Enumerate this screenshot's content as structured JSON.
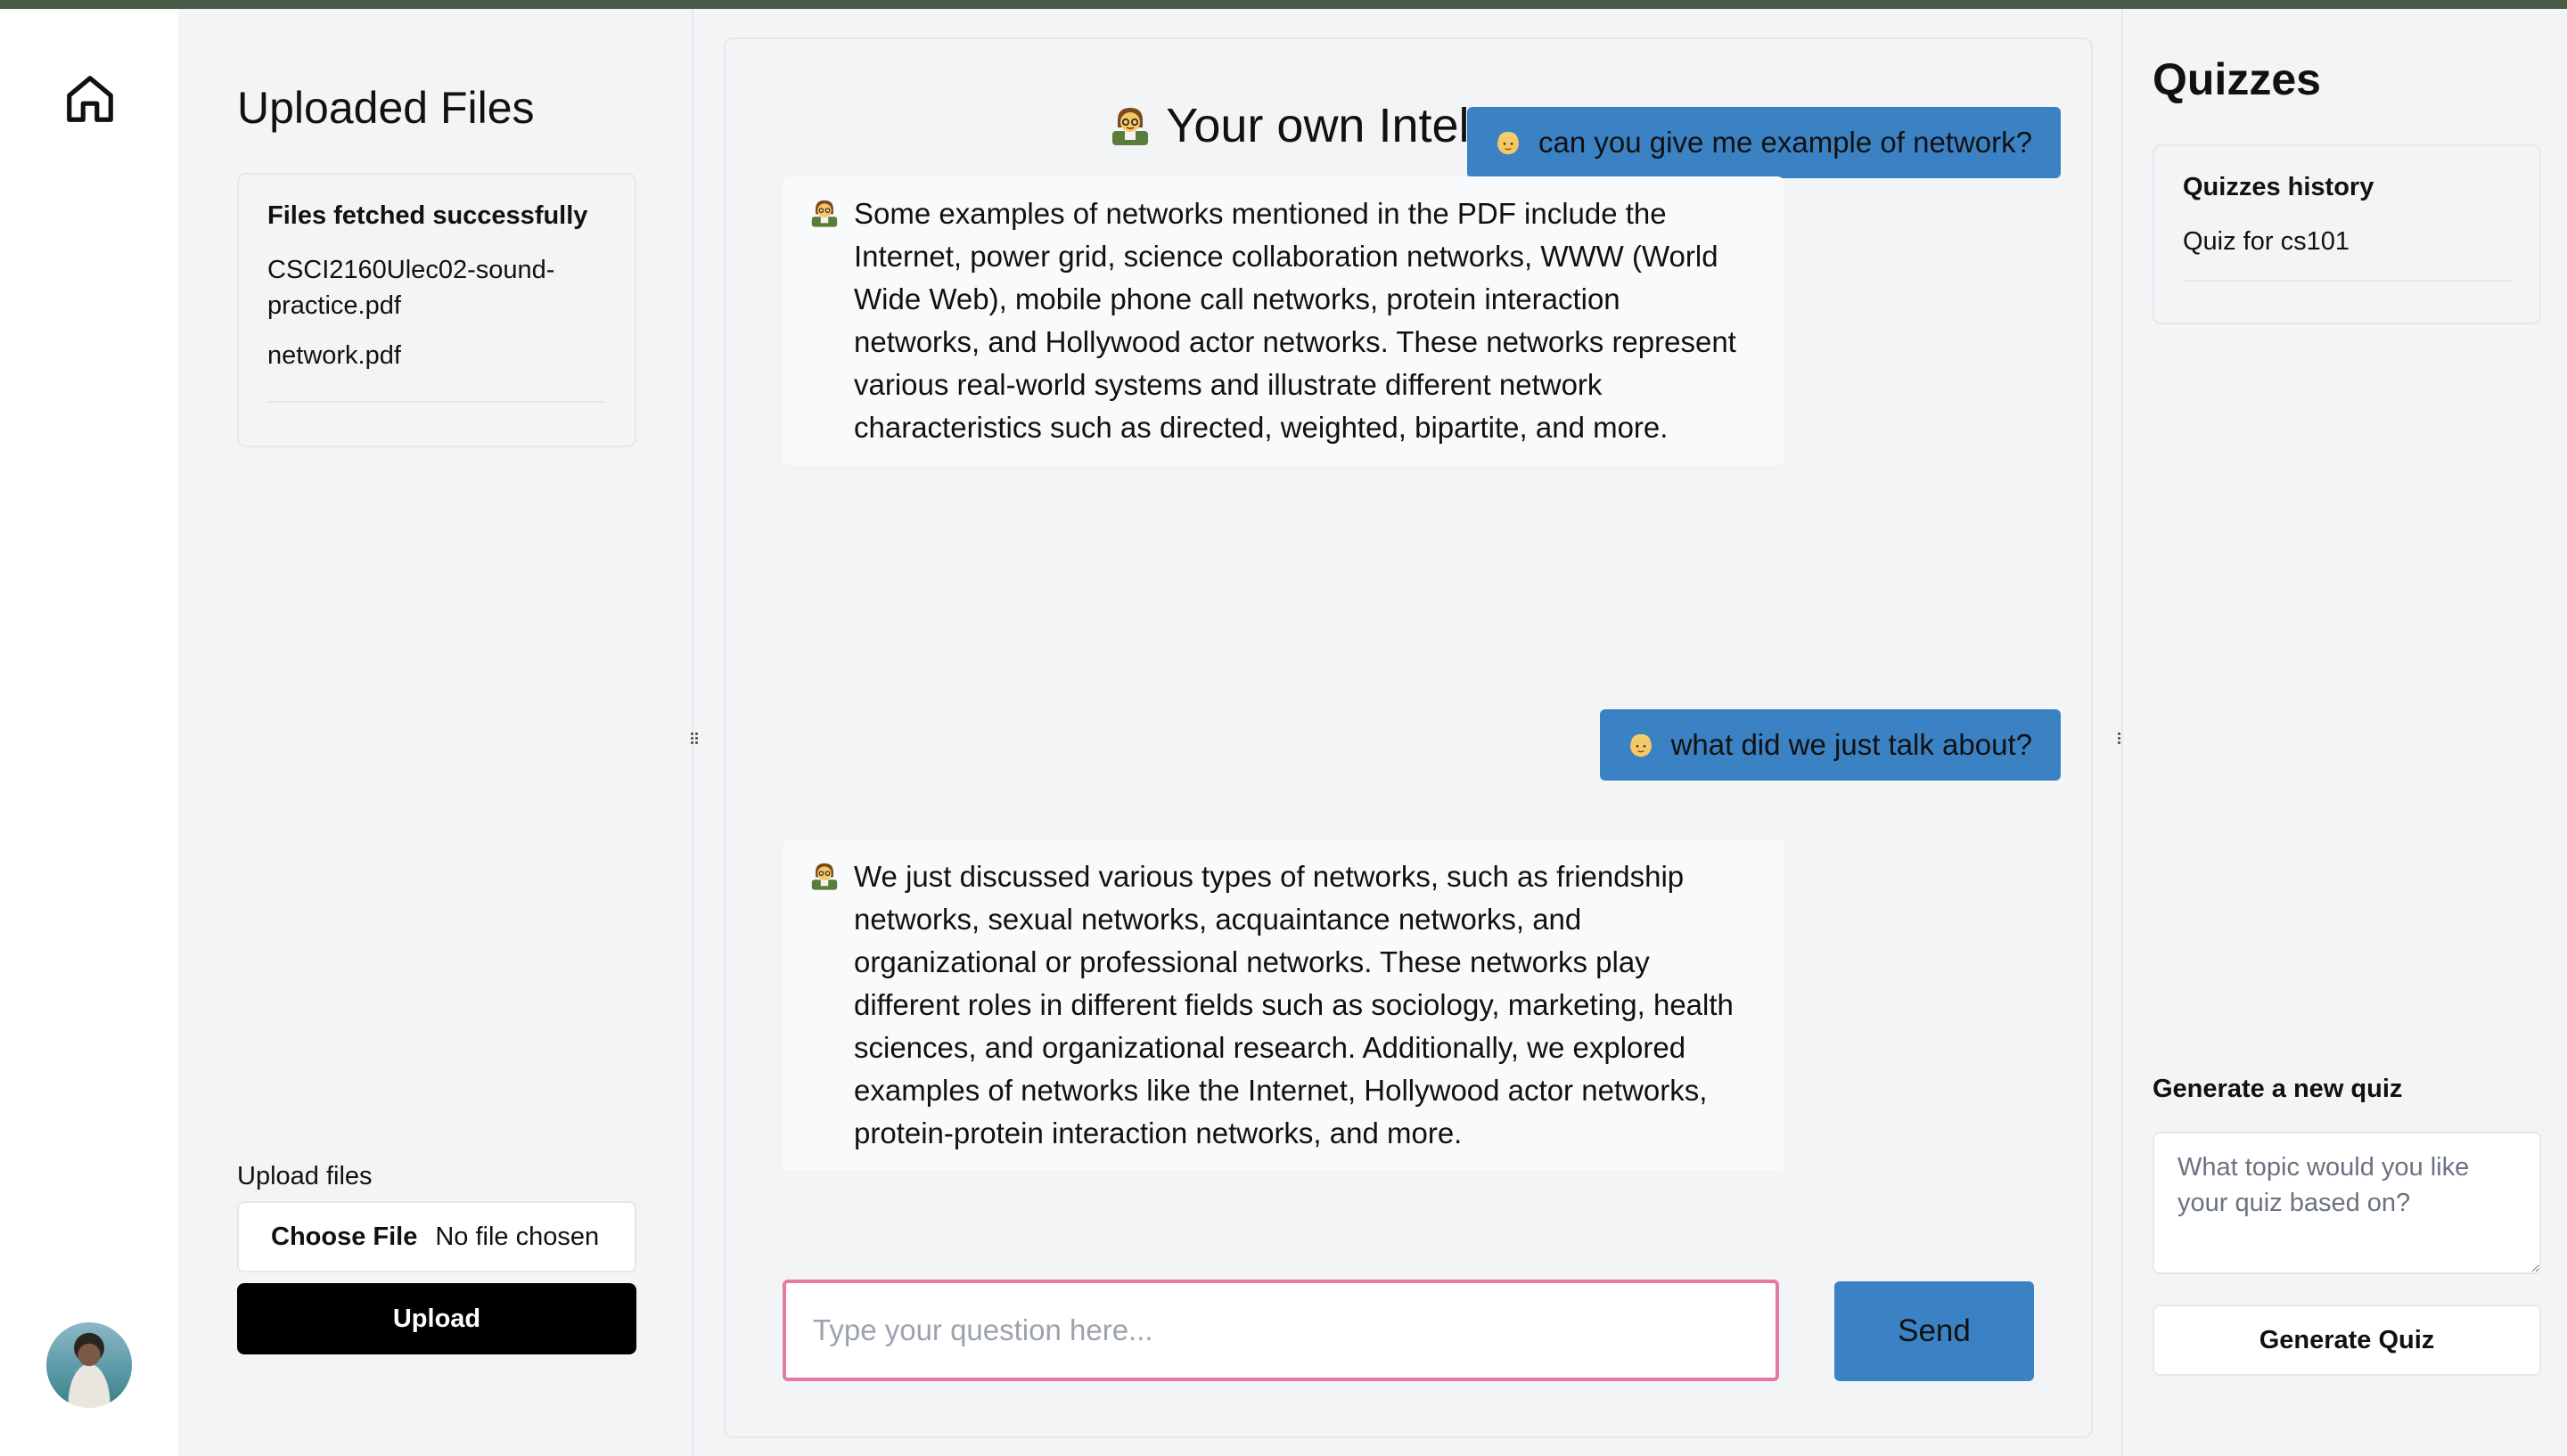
{
  "icons": {
    "home": "home-icon",
    "avatar": "user-avatar",
    "tutor": "teacher-emoji",
    "user": "person-emoji",
    "drag": "drag-handle-icon"
  },
  "files": {
    "title": "Uploaded Files",
    "status": "Files fetched successfully",
    "items": [
      "CSCI2160Ulec02-sound-practice.pdf",
      "network.pdf"
    ],
    "upload_label": "Upload files",
    "choose_label": "Choose File",
    "no_file_label": "No file chosen",
    "upload_button": "Upload"
  },
  "chat": {
    "title": "Your own Intelligent Tutor",
    "messages": [
      {
        "role": "user",
        "text": "can you give me example of network?"
      },
      {
        "role": "tutor",
        "text": "Some examples of networks mentioned in the PDF include the Internet, power grid, science collaboration networks, WWW (World Wide Web), mobile phone call networks, protein interaction networks, and Hollywood actor networks. These networks represent various real-world systems and illustrate different network characteristics such as directed, weighted, bipartite, and more."
      },
      {
        "role": "user",
        "text": "what did we just talk about?"
      },
      {
        "role": "tutor",
        "text": "We just discussed various types of networks, such as friendship networks, sexual networks, acquaintance networks, and organizational or professional networks. These networks play different roles in different fields such as sociology, marketing, health sciences, and organizational research. Additionally, we explored examples of networks like the Internet, Hollywood actor networks, protein-protein interaction networks, and more."
      }
    ],
    "input_value": "",
    "input_placeholder": "Type your question here...",
    "send_button": "Send"
  },
  "quizzes": {
    "title": "Quizzes",
    "history_title": "Quizzes history",
    "items": [
      "Quiz for cs101"
    ],
    "generate_label": "Generate a new quiz",
    "topic_value": "",
    "topic_placeholder": "What topic would you like your quiz based on?",
    "generate_button": "Generate Quiz"
  },
  "colors": {
    "accent": "#3b82c4",
    "top_bar": "#4a5b47",
    "input_focus": "#e27aa5",
    "upload_button": "#000000",
    "background": "#f3f4f6"
  }
}
